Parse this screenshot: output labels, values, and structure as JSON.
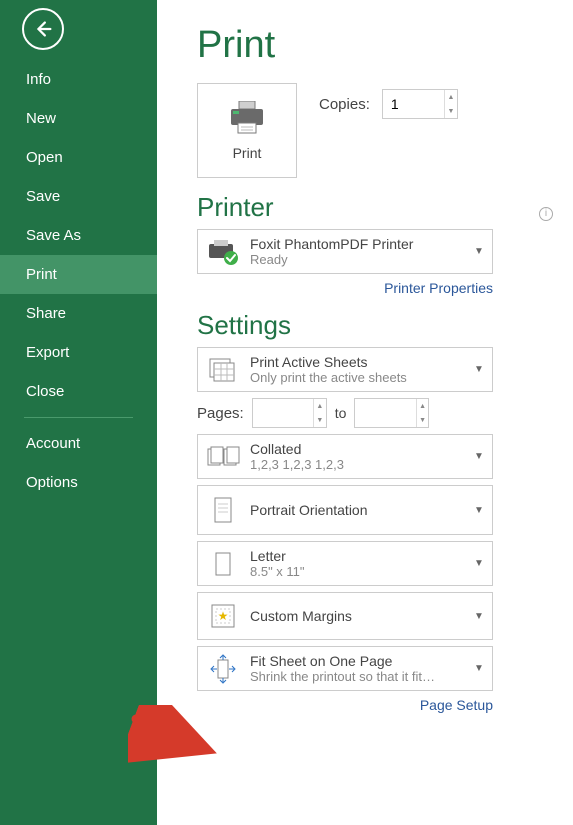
{
  "sidebar": {
    "items": [
      {
        "label": "Info",
        "active": false
      },
      {
        "label": "New",
        "active": false
      },
      {
        "label": "Open",
        "active": false
      },
      {
        "label": "Save",
        "active": false
      },
      {
        "label": "Save As",
        "active": false
      },
      {
        "label": "Print",
        "active": true
      },
      {
        "label": "Share",
        "active": false
      },
      {
        "label": "Export",
        "active": false
      },
      {
        "label": "Close",
        "active": false
      }
    ],
    "footer_items": [
      {
        "label": "Account"
      },
      {
        "label": "Options"
      }
    ]
  },
  "page": {
    "title": "Print",
    "print_button_label": "Print",
    "copies_label": "Copies:",
    "copies_value": "1"
  },
  "printer": {
    "heading": "Printer",
    "selected_name": "Foxit PhantomPDF Printer",
    "selected_status": "Ready",
    "properties_link": "Printer Properties"
  },
  "settings": {
    "heading": "Settings",
    "pages_label": "Pages:",
    "pages_to": "to",
    "pages_from": "",
    "pages_to_val": "",
    "page_setup_link": "Page Setup",
    "items": [
      {
        "title": "Print Active Sheets",
        "subtitle": "Only print the active sheets",
        "icon": "sheets"
      },
      {
        "title": "Collated",
        "subtitle": "1,2,3    1,2,3    1,2,3",
        "icon": "collated"
      },
      {
        "title": "Portrait Orientation",
        "subtitle": "",
        "icon": "portrait"
      },
      {
        "title": "Letter",
        "subtitle": "8.5\" x 11\"",
        "icon": "letter"
      },
      {
        "title": "Custom Margins",
        "subtitle": "",
        "icon": "margins"
      },
      {
        "title": "Fit Sheet on One Page",
        "subtitle": "Shrink the printout so that it fit…",
        "icon": "fit"
      }
    ]
  }
}
